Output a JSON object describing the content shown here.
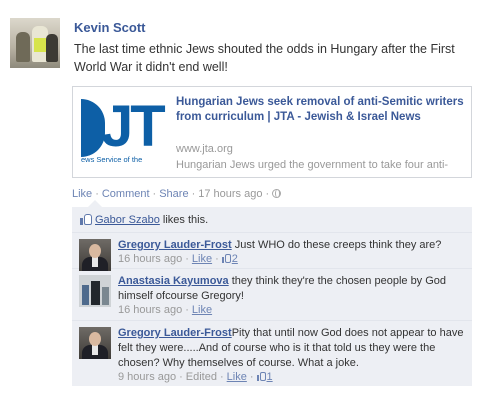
{
  "post": {
    "author": "Kevin Scott",
    "text": "The last time ethnic Jews shouted the odds in Hungary after the First World War it didn't end well!",
    "link": {
      "thumb_text": "JT",
      "thumb_caption": "ews Service of the",
      "title": "Hungarian Jews seek removal of anti-Semitic writers from curriculum | JTA - Jewish & Israel News",
      "domain": "www.jta.org",
      "snippet": "Hungarian Jews urged the government to take four anti-"
    },
    "actions": {
      "like": "Like",
      "comment": "Comment",
      "share": "Share",
      "time": "17 hours ago",
      "separator": "·",
      "audience_icon": "globe-icon"
    }
  },
  "feedback": {
    "likers": "Gabor Szabo",
    "likes_suffix": "likes this.",
    "comments": [
      {
        "author": "Gregory Lauder-Frost",
        "text": "Just WHO do these creeps think they are?",
        "time": "16 hours ago",
        "like": "Like",
        "like_count": "2",
        "edited": ""
      },
      {
        "author": "Anastasia Kayumova",
        "text": "they think they're the chosen people by God himself ofcourse Gregory!",
        "time": "16 hours ago",
        "like": "Like",
        "like_count": "",
        "edited": ""
      },
      {
        "author": "Gregory Lauder-Frost",
        "text": "Pity that until now God does not appear to have felt they were.....And of course who is it that told us they were the chosen? Why themselves of course. What a joke.",
        "time": "9 hours ago",
        "like": "Like",
        "like_count": "1",
        "edited": "Edited"
      }
    ]
  },
  "colors": {
    "link": "#3b5998",
    "muted_link": "#6d84b4",
    "feedback_bg": "#edeff4",
    "jta_blue": "#0d5fa6"
  }
}
